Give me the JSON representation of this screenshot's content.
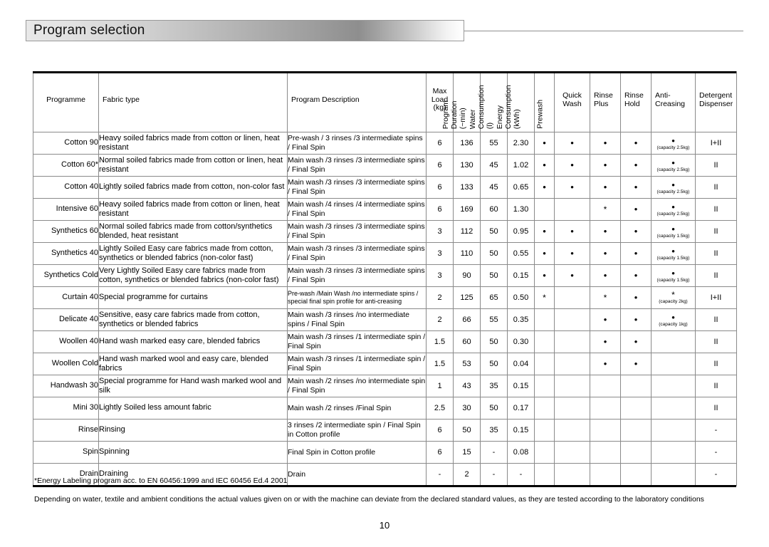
{
  "header": {
    "title": "Program selection"
  },
  "table": {
    "columns": [
      {
        "key": "programme",
        "label": "Programme",
        "orient": "horizontal",
        "align": "center"
      },
      {
        "key": "fabric",
        "label": "Fabric type",
        "orient": "horizontal",
        "align": "left"
      },
      {
        "key": "desc",
        "label": "Program Description",
        "orient": "horizontal",
        "align": "left"
      },
      {
        "key": "load",
        "label": "Max Load (kg)",
        "orient": "horizontal",
        "align": "center"
      },
      {
        "key": "duration",
        "label": "Program Duration (~min)",
        "orient": "vertical",
        "lines": [
          "Program",
          "Duration",
          "(~min)"
        ]
      },
      {
        "key": "water",
        "label": "Water Consumption (l)",
        "orient": "vertical",
        "lines": [
          "Water",
          "Consumption",
          "(l)"
        ]
      },
      {
        "key": "energy",
        "label": "Energy Consumption (kWh)",
        "orient": "vertical",
        "lines": [
          "Energy",
          "Consumption",
          "(kWh)"
        ]
      },
      {
        "key": "prewash",
        "label": "Prewash",
        "orient": "vertical",
        "lines": [
          "Prewash"
        ]
      },
      {
        "key": "quickwash",
        "label": "Quick Wash",
        "orient": "horizontal",
        "align": "center"
      },
      {
        "key": "rinseplus",
        "label": "Rinse Plus",
        "orient": "horizontal",
        "align": "left"
      },
      {
        "key": "rinsehold",
        "label": "Rinse Hold",
        "orient": "horizontal",
        "align": "left"
      },
      {
        "key": "anticrease",
        "label": "Anti-Creasing",
        "orient": "horizontal",
        "align": "left"
      },
      {
        "key": "dispenser",
        "label": "Detergent Dispenser",
        "orient": "horizontal",
        "align": "left"
      }
    ],
    "header_lines": {
      "programme": [
        "Programme"
      ],
      "fabric": [
        "Fabric type"
      ],
      "desc": [
        "Program Description"
      ],
      "load": [
        "Max",
        "Load",
        "(kg)"
      ],
      "quickwash": [
        "Quick",
        "Wash"
      ],
      "rinseplus": [
        "Rinse",
        "Plus"
      ],
      "rinsehold": [
        "Rinse",
        "Hold"
      ],
      "anticrease": [
        "Anti-",
        "Creasing"
      ],
      "dispenser": [
        "Detergent",
        "Dispenser"
      ]
    },
    "rows": [
      {
        "programme": "Cotton 90",
        "fabric": "Heavy soiled fabrics made from cotton or linen, heat resistant",
        "desc": "Pre-wash / 3 rinses /3 intermediate spins / Final Spin",
        "desc_small": false,
        "load": "6",
        "duration": "136",
        "water": "55",
        "energy": "2.30",
        "prewash": "•",
        "quickwash": "•",
        "rinseplus": "•",
        "rinsehold": "•",
        "anticrease": "•",
        "anticrease_capacity": "(capacity 2.5kg)",
        "dispenser": "I+II"
      },
      {
        "programme": "Cotton 60*",
        "fabric": "Normal soiled fabrics made from cotton or linen, heat resistant",
        "desc": "Main wash /3 rinses /3 intermediate spins / Final Spin",
        "desc_small": false,
        "load": "6",
        "duration": "130",
        "water": "45",
        "energy": "1.02",
        "prewash": "•",
        "quickwash": "•",
        "rinseplus": "•",
        "rinsehold": "•",
        "anticrease": "•",
        "anticrease_capacity": "(capacity 2.5kg)",
        "dispenser": "II"
      },
      {
        "programme": "Cotton 40",
        "fabric": "Lightly soiled fabrics made from cotton, non-color fast",
        "desc": "Main wash /3 rinses /3 intermediate spins / Final Spin",
        "desc_small": false,
        "load": "6",
        "duration": "133",
        "water": "45",
        "energy": "0.65",
        "prewash": "•",
        "quickwash": "•",
        "rinseplus": "•",
        "rinsehold": "•",
        "anticrease": "•",
        "anticrease_capacity": "(capacity 2.5kg)",
        "dispenser": "II"
      },
      {
        "programme": "Intensive 60",
        "fabric": "Heavy soiled fabrics made from cotton or linen, heat resistant",
        "desc": "Main wash /4 rinses /4 intermediate spins / Final Spin",
        "desc_small": false,
        "load": "6",
        "duration": "169",
        "water": "60",
        "energy": "1.30",
        "prewash": "",
        "quickwash": "",
        "rinseplus": "*",
        "rinsehold": "•",
        "anticrease": "•",
        "anticrease_capacity": "(capacity 2.5kg)",
        "dispenser": "II"
      },
      {
        "programme": "Synthetics 60",
        "fabric": "Normal soiled fabrics made from cotton/synthetics blended, heat resistant",
        "desc": "Main wash /3 rinses /3 intermediate spins / Final Spin",
        "desc_small": false,
        "load": "3",
        "duration": "112",
        "water": "50",
        "energy": "0.95",
        "prewash": "•",
        "quickwash": "•",
        "rinseplus": "•",
        "rinsehold": "•",
        "anticrease": "•",
        "anticrease_capacity": "(capacity 1.5kg)",
        "dispenser": "II"
      },
      {
        "programme": "Synthetics 40",
        "fabric": "Lightly Soiled Easy care fabrics made from cotton, synthetics or blended fabrics (non-color fast)",
        "desc": "Main wash /3 rinses /3 intermediate spins / Final Spin",
        "desc_small": false,
        "load": "3",
        "duration": "110",
        "water": "50",
        "energy": "0.55",
        "prewash": "•",
        "quickwash": "•",
        "rinseplus": "•",
        "rinsehold": "•",
        "anticrease": "•",
        "anticrease_capacity": "(capacity 1.5kg)",
        "dispenser": "II"
      },
      {
        "programme": "Synthetics Cold",
        "fabric": "Very Lightly Soiled Easy care fabrics made from cotton, synthetics or blended fabrics (non-color fast)",
        "desc": "Main wash /3 rinses /3 intermediate spins / Final Spin",
        "desc_small": false,
        "load": "3",
        "duration": "90",
        "water": "50",
        "energy": "0.15",
        "prewash": "•",
        "quickwash": "•",
        "rinseplus": "•",
        "rinsehold": "•",
        "anticrease": "•",
        "anticrease_capacity": "(capacity 1.5kg)",
        "dispenser": "II"
      },
      {
        "programme": "Curtain 40",
        "fabric": "Special programme for curtains",
        "desc": "Pre-wash /Main Wash /no intermediate spins / special final spin profile for anti-creasing",
        "desc_small": true,
        "load": "2",
        "duration": "125",
        "water": "65",
        "energy": "0.50",
        "prewash": "*",
        "quickwash": "",
        "rinseplus": "*",
        "rinsehold": "•",
        "anticrease": "*",
        "anticrease_capacity": "(capacity 2kg)",
        "dispenser": "I+II"
      },
      {
        "programme": "Delicate 40",
        "fabric": "Sensitive, easy care fabrics made from cotton, synthetics or blended fabrics",
        "desc": "Main wash /3 rinses /no intermediate spins / Final Spin",
        "desc_small": false,
        "load": "2",
        "duration": "66",
        "water": "55",
        "energy": "0.35",
        "prewash": "",
        "quickwash": "",
        "rinseplus": "•",
        "rinsehold": "•",
        "anticrease": "•",
        "anticrease_capacity": "(capacity 1kg)",
        "dispenser": "II"
      },
      {
        "programme": "Woollen 40",
        "fabric": "Hand wash marked easy care, blended fabrics",
        "desc": "Main wash /3 rinses /1 intermediate spin / Final Spin",
        "desc_small": false,
        "load": "1.5",
        "duration": "60",
        "water": "50",
        "energy": "0.30",
        "prewash": "",
        "quickwash": "",
        "rinseplus": "•",
        "rinsehold": "•",
        "anticrease": "",
        "anticrease_capacity": "",
        "dispenser": "II"
      },
      {
        "programme": "Woollen Cold",
        "fabric": "Hand wash marked wool and easy care, blended fabrics",
        "desc": "Main wash /3 rinses /1 intermediate spin / Final Spin",
        "desc_small": false,
        "load": "1.5",
        "duration": "53",
        "water": "50",
        "energy": "0.04",
        "prewash": "",
        "quickwash": "",
        "rinseplus": "•",
        "rinsehold": "•",
        "anticrease": "",
        "anticrease_capacity": "",
        "dispenser": "II"
      },
      {
        "programme": "Handwash 30",
        "fabric": "Special programme for Hand wash marked wool and silk",
        "desc": "Main wash /2 rinses /no intermediate spin / Final Spin",
        "desc_small": false,
        "load": "1",
        "duration": "43",
        "water": "35",
        "energy": "0.15",
        "prewash": "",
        "quickwash": "",
        "rinseplus": "",
        "rinsehold": "",
        "anticrease": "",
        "anticrease_capacity": "",
        "dispenser": "II"
      },
      {
        "programme": "Mini 30",
        "fabric": "Lightly Soiled less amount fabric",
        "desc": "Main wash /2 rinses /Final Spin",
        "desc_small": false,
        "load": "2.5",
        "duration": "30",
        "water": "50",
        "energy": "0.17",
        "prewash": "",
        "quickwash": "",
        "rinseplus": "",
        "rinsehold": "",
        "anticrease": "",
        "anticrease_capacity": "",
        "dispenser": "II"
      },
      {
        "programme": "Rinse",
        "fabric": "Rinsing",
        "desc": "3 rinses /2 intermediate spin / Final Spin in Cotton profile",
        "desc_small": false,
        "load": "6",
        "duration": "50",
        "water": "35",
        "energy": "0.15",
        "prewash": "",
        "quickwash": "",
        "rinseplus": "",
        "rinsehold": "",
        "anticrease": "",
        "anticrease_capacity": "",
        "dispenser": "-"
      },
      {
        "programme": "Spin",
        "fabric": "Spinning",
        "desc": "Final Spin in Cotton profile",
        "desc_small": false,
        "load": "6",
        "duration": "15",
        "water": "-",
        "energy": "0.08",
        "prewash": "",
        "quickwash": "",
        "rinseplus": "",
        "rinsehold": "",
        "anticrease": "",
        "anticrease_capacity": "",
        "dispenser": "-"
      },
      {
        "programme": "Drain",
        "fabric": "Draining",
        "desc": "Drain",
        "desc_small": false,
        "load": "-",
        "duration": "2",
        "water": "-",
        "energy": "-",
        "prewash": "",
        "quickwash": "",
        "rinseplus": "",
        "rinsehold": "",
        "anticrease": "",
        "anticrease_capacity": "",
        "dispenser": "-"
      }
    ]
  },
  "notes": {
    "footnote": "*Energy Labeling program acc. to EN 60456:1999 and IEC 60456 Ed.4 2001",
    "disclaimer": "Depending on water, textile and ambient conditions the actual values given on or with the machine can deviate from the declared standard values, as they are tested according to the laboratory conditions"
  },
  "page_number": "10"
}
